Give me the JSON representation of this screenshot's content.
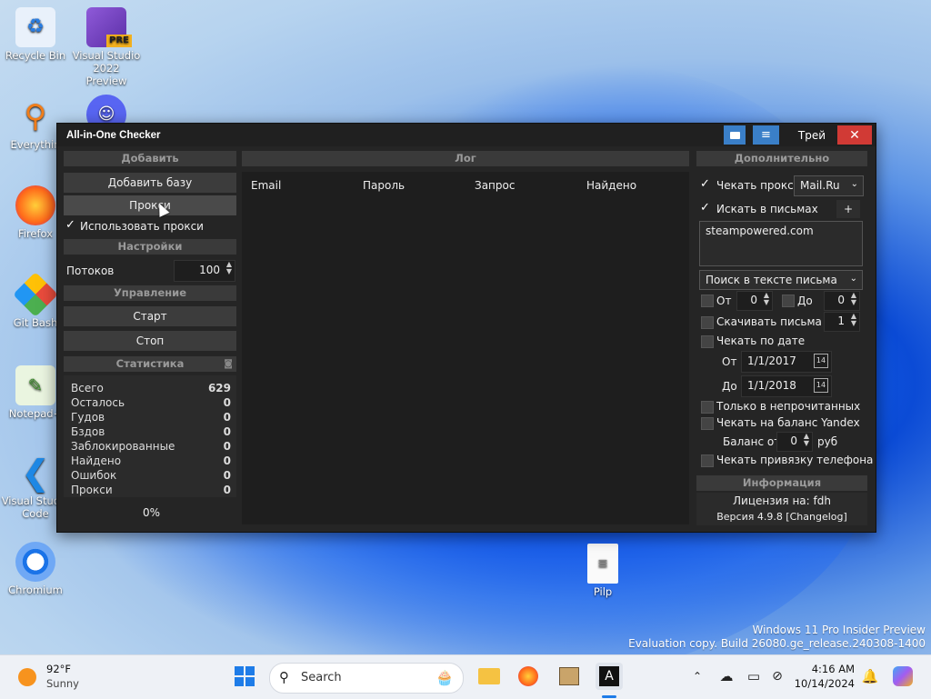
{
  "desktop": {
    "icons": [
      {
        "label": "Recycle Bin"
      },
      {
        "label": "Visual Studio 2022 Preview",
        "badge": "PRE"
      },
      {
        "label": "Everythin"
      },
      {
        "label": "Firefox"
      },
      {
        "label": "Git Bash"
      },
      {
        "label": "Notepad+"
      },
      {
        "label": "Visual Studio Code"
      },
      {
        "label": "Chromium"
      },
      {
        "label": "Pilp"
      }
    ],
    "watermark": {
      "line1": "Windows 11 Pro Insider Preview",
      "line2": "Evaluation copy. Build 26080.ge_release.240308-1400"
    }
  },
  "window": {
    "title": "All-in-One Checker",
    "tray_button": "Трей",
    "close": "✕"
  },
  "left": {
    "add_header": "Добавить",
    "add_base_button": "Добавить базу",
    "proxy_button": "Прокси",
    "use_proxy_label": "Использовать прокси",
    "use_proxy_checked": true,
    "settings_header": "Настройки",
    "threads_label": "Потоков",
    "threads_value": "100",
    "control_header": "Управление",
    "start_button": "Старт",
    "stop_button": "Стоп",
    "stats_header": "Статистика",
    "stats": [
      {
        "label": "Всего",
        "value": "629"
      },
      {
        "label": "Осталось",
        "value": "0"
      },
      {
        "label": "Гудов",
        "value": "0"
      },
      {
        "label": "Бздов",
        "value": "0"
      },
      {
        "label": "Заблокированные",
        "value": "0"
      },
      {
        "label": "Найдено",
        "value": "0"
      },
      {
        "label": "Ошибок",
        "value": "0"
      },
      {
        "label": "Прокси",
        "value": "0"
      }
    ],
    "progress": "0%"
  },
  "log": {
    "header": "Лог",
    "columns": [
      "Email",
      "Пароль",
      "Запрос",
      "Найдено"
    ]
  },
  "right": {
    "extra_header": "Дополнительно",
    "check_proxy_label": "Чекать прокси",
    "check_proxy_checked": true,
    "mail_select": "Mail.Ru",
    "search_in_mail_label": "Искать в письмах",
    "search_in_mail_checked": true,
    "plus": "+",
    "search_text": "steampowered.com",
    "search_mode_select": "Поиск в тексте письма",
    "from_label": "От",
    "from_value": "0",
    "to_label": "До",
    "to_value": "0",
    "download_mail_label": "Скачивать письма",
    "download_mail_value": "1",
    "check_by_date_label": "Чекать по дате",
    "date_from_label": "От",
    "date_from": "1/1/2017",
    "date_to_label": "До",
    "date_to": "1/1/2018",
    "only_unread_label": "Только в непрочитанных",
    "check_yandex_label": "Чекать на баланс Yandex",
    "balance_from_label": "Баланс от",
    "balance_value": "0",
    "balance_unit": "руб",
    "check_phone_label": "Чекать привязку телефона",
    "info_header": "Информация",
    "license": "Лицензия на: fdh",
    "version": "Версия 4.9.8 [Changelog]"
  },
  "taskbar": {
    "weather_temp": "92°F",
    "weather_desc": "Sunny",
    "search_placeholder": "Search",
    "time": "4:16 AM",
    "date": "10/14/2024"
  }
}
